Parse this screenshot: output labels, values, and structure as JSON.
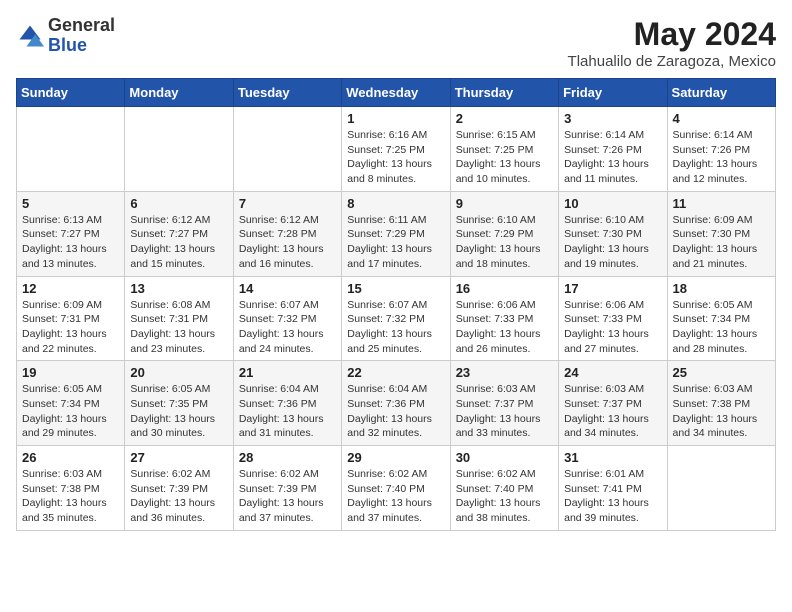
{
  "logo": {
    "general": "General",
    "blue": "Blue"
  },
  "header": {
    "month": "May 2024",
    "location": "Tlahualilo de Zaragoza, Mexico"
  },
  "weekdays": [
    "Sunday",
    "Monday",
    "Tuesday",
    "Wednesday",
    "Thursday",
    "Friday",
    "Saturday"
  ],
  "weeks": [
    [
      {
        "day": "",
        "detail": ""
      },
      {
        "day": "",
        "detail": ""
      },
      {
        "day": "",
        "detail": ""
      },
      {
        "day": "1",
        "detail": "Sunrise: 6:16 AM\nSunset: 7:25 PM\nDaylight: 13 hours\nand 8 minutes."
      },
      {
        "day": "2",
        "detail": "Sunrise: 6:15 AM\nSunset: 7:25 PM\nDaylight: 13 hours\nand 10 minutes."
      },
      {
        "day": "3",
        "detail": "Sunrise: 6:14 AM\nSunset: 7:26 PM\nDaylight: 13 hours\nand 11 minutes."
      },
      {
        "day": "4",
        "detail": "Sunrise: 6:14 AM\nSunset: 7:26 PM\nDaylight: 13 hours\nand 12 minutes."
      }
    ],
    [
      {
        "day": "5",
        "detail": "Sunrise: 6:13 AM\nSunset: 7:27 PM\nDaylight: 13 hours\nand 13 minutes."
      },
      {
        "day": "6",
        "detail": "Sunrise: 6:12 AM\nSunset: 7:27 PM\nDaylight: 13 hours\nand 15 minutes."
      },
      {
        "day": "7",
        "detail": "Sunrise: 6:12 AM\nSunset: 7:28 PM\nDaylight: 13 hours\nand 16 minutes."
      },
      {
        "day": "8",
        "detail": "Sunrise: 6:11 AM\nSunset: 7:29 PM\nDaylight: 13 hours\nand 17 minutes."
      },
      {
        "day": "9",
        "detail": "Sunrise: 6:10 AM\nSunset: 7:29 PM\nDaylight: 13 hours\nand 18 minutes."
      },
      {
        "day": "10",
        "detail": "Sunrise: 6:10 AM\nSunset: 7:30 PM\nDaylight: 13 hours\nand 19 minutes."
      },
      {
        "day": "11",
        "detail": "Sunrise: 6:09 AM\nSunset: 7:30 PM\nDaylight: 13 hours\nand 21 minutes."
      }
    ],
    [
      {
        "day": "12",
        "detail": "Sunrise: 6:09 AM\nSunset: 7:31 PM\nDaylight: 13 hours\nand 22 minutes."
      },
      {
        "day": "13",
        "detail": "Sunrise: 6:08 AM\nSunset: 7:31 PM\nDaylight: 13 hours\nand 23 minutes."
      },
      {
        "day": "14",
        "detail": "Sunrise: 6:07 AM\nSunset: 7:32 PM\nDaylight: 13 hours\nand 24 minutes."
      },
      {
        "day": "15",
        "detail": "Sunrise: 6:07 AM\nSunset: 7:32 PM\nDaylight: 13 hours\nand 25 minutes."
      },
      {
        "day": "16",
        "detail": "Sunrise: 6:06 AM\nSunset: 7:33 PM\nDaylight: 13 hours\nand 26 minutes."
      },
      {
        "day": "17",
        "detail": "Sunrise: 6:06 AM\nSunset: 7:33 PM\nDaylight: 13 hours\nand 27 minutes."
      },
      {
        "day": "18",
        "detail": "Sunrise: 6:05 AM\nSunset: 7:34 PM\nDaylight: 13 hours\nand 28 minutes."
      }
    ],
    [
      {
        "day": "19",
        "detail": "Sunrise: 6:05 AM\nSunset: 7:34 PM\nDaylight: 13 hours\nand 29 minutes."
      },
      {
        "day": "20",
        "detail": "Sunrise: 6:05 AM\nSunset: 7:35 PM\nDaylight: 13 hours\nand 30 minutes."
      },
      {
        "day": "21",
        "detail": "Sunrise: 6:04 AM\nSunset: 7:36 PM\nDaylight: 13 hours\nand 31 minutes."
      },
      {
        "day": "22",
        "detail": "Sunrise: 6:04 AM\nSunset: 7:36 PM\nDaylight: 13 hours\nand 32 minutes."
      },
      {
        "day": "23",
        "detail": "Sunrise: 6:03 AM\nSunset: 7:37 PM\nDaylight: 13 hours\nand 33 minutes."
      },
      {
        "day": "24",
        "detail": "Sunrise: 6:03 AM\nSunset: 7:37 PM\nDaylight: 13 hours\nand 34 minutes."
      },
      {
        "day": "25",
        "detail": "Sunrise: 6:03 AM\nSunset: 7:38 PM\nDaylight: 13 hours\nand 34 minutes."
      }
    ],
    [
      {
        "day": "26",
        "detail": "Sunrise: 6:03 AM\nSunset: 7:38 PM\nDaylight: 13 hours\nand 35 minutes."
      },
      {
        "day": "27",
        "detail": "Sunrise: 6:02 AM\nSunset: 7:39 PM\nDaylight: 13 hours\nand 36 minutes."
      },
      {
        "day": "28",
        "detail": "Sunrise: 6:02 AM\nSunset: 7:39 PM\nDaylight: 13 hours\nand 37 minutes."
      },
      {
        "day": "29",
        "detail": "Sunrise: 6:02 AM\nSunset: 7:40 PM\nDaylight: 13 hours\nand 37 minutes."
      },
      {
        "day": "30",
        "detail": "Sunrise: 6:02 AM\nSunset: 7:40 PM\nDaylight: 13 hours\nand 38 minutes."
      },
      {
        "day": "31",
        "detail": "Sunrise: 6:01 AM\nSunset: 7:41 PM\nDaylight: 13 hours\nand 39 minutes."
      },
      {
        "day": "",
        "detail": ""
      }
    ]
  ]
}
